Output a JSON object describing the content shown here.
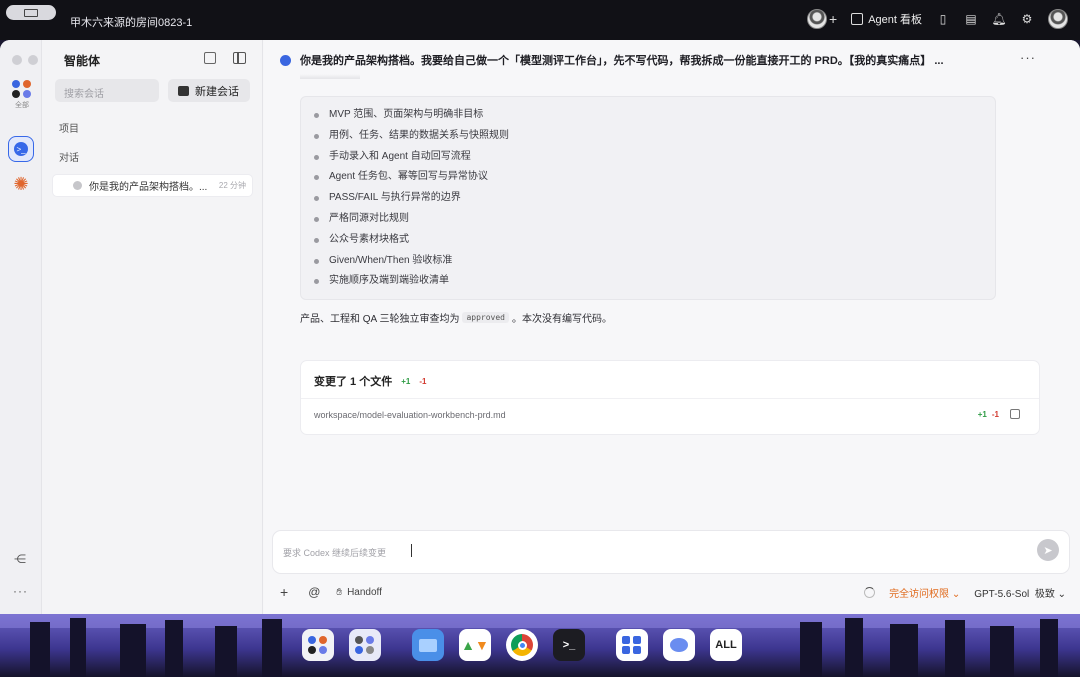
{
  "topbar": {
    "room_title": "甲木六来源的房间0823-1",
    "agent_board_label": "Agent 看板"
  },
  "sidebar": {
    "title": "智能体",
    "rail_all_label": "全部",
    "search_placeholder": "搜索会话",
    "new_chat_label": "新建会话",
    "section_projects": "项目",
    "section_conversations": "对话",
    "conversations": [
      {
        "title": "你是我的产品架构搭档。...",
        "time": "22 分钟"
      }
    ]
  },
  "main": {
    "header_title": "你是我的产品架构搭档。我要给自己做一个「模型测评工作台」，先不写代码，帮我拆成一份能直接开工的 PRD。【我的真实痛点】 ...",
    "bullets": [
      "MVP 范围、页面架构与明确非目标",
      "用例、任务、结果的数据关系与快照规则",
      "手动录入和 Agent 自动回写流程",
      "Agent 任务包、幂等回写与异常协议",
      "PASS/FAIL 与执行异常的边界",
      "严格同源对比规则",
      "公众号素材块格式",
      "Given/When/Then 验收标准",
      "实施顺序及端到端验收清单"
    ],
    "summary_before": "产品、工程和 QA 三轮独立审查均为",
    "summary_code": "approved",
    "summary_after": "。本次没有编写代码。",
    "files_changed": {
      "title": "变更了 1 个文件",
      "added": "+1",
      "removed": "-1",
      "path": "workspace/model-evaluation-workbench-prd.md",
      "file_added": "+1",
      "file_removed": "-1"
    },
    "composer_placeholder": "要求 Codex 继续后续变更",
    "toolbar": {
      "handoff_label": "Handoff",
      "access_label": "完全访问权限",
      "model_label": "GPT-5.6-Sol",
      "level_label": "极致"
    }
  },
  "dock": {
    "all_label": "ALL"
  },
  "colors": {
    "accent_blue": "#3768e8",
    "add_green": "#2e9b44",
    "del_red": "#d2392f",
    "access_orange": "#e06a1c"
  }
}
